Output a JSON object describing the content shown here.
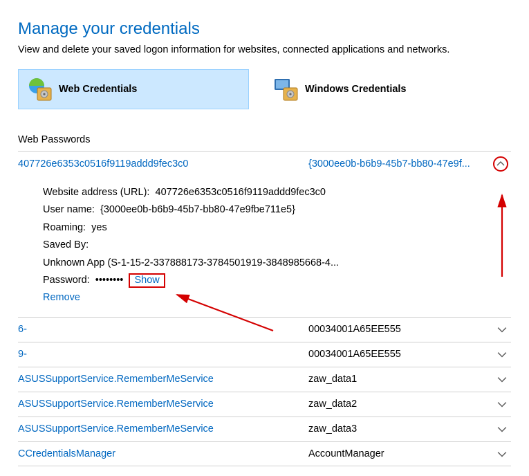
{
  "title": "Manage your credentials",
  "subtitle": "View and delete your saved logon information for websites, connected applications and networks.",
  "tabs": {
    "web": "Web Credentials",
    "windows": "Windows Credentials"
  },
  "section_header": "Web Passwords",
  "expanded": {
    "id": "407726e6353c0516f9119addd9fec3c0",
    "guid_short": "{3000ee0b-b6b9-45b7-bb80-47e9f...",
    "website_label": "Website address (URL):",
    "website_value": "407726e6353c0516f9119addd9fec3c0",
    "username_label": "User name:",
    "username_value": "{3000ee0b-b6b9-45b7-bb80-47e9fbe711e5}",
    "roaming_label": "Roaming:",
    "roaming_value": "yes",
    "savedby_label": "Saved By:",
    "savedby_value": "Unknown App (S-1-15-2-337888173-3784501919-3848985668-4...",
    "password_label": "Password:",
    "password_mask": "••••••••",
    "show": "Show",
    "remove": "Remove"
  },
  "rows": [
    {
      "left": "6-",
      "right": "00034001A65EE555"
    },
    {
      "left": "9-",
      "right": "00034001A65EE555"
    },
    {
      "left": "ASUSSupportService.RememberMeService",
      "right": "zaw_data1"
    },
    {
      "left": "ASUSSupportService.RememberMeService",
      "right": "zaw_data2"
    },
    {
      "left": "ASUSSupportService.RememberMeService",
      "right": "zaw_data3"
    },
    {
      "left": "CCredentialsManager",
      "right": "AccountManager"
    }
  ]
}
